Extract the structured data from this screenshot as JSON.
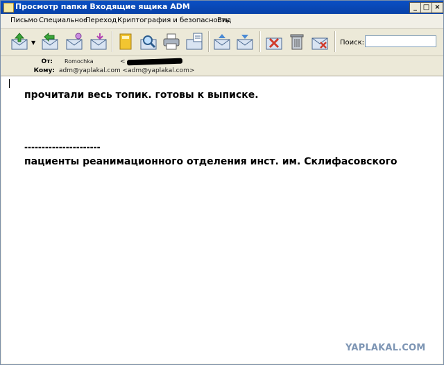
{
  "window": {
    "title": "Просмотр папки Входящие ящика ADM",
    "controls": [
      "_",
      "□",
      "×"
    ]
  },
  "menu": [
    "Письмо",
    "Специальное",
    "Переход",
    "Криптография и безопасность",
    "Вид"
  ],
  "toolbar": {
    "buttons": [
      "get-mail-icon",
      "reply-icon",
      "reply-all-icon",
      "forward-icon",
      "address-book-icon",
      "find-icon",
      "print-icon",
      "compose-icon",
      "previous-message-icon",
      "next-message-icon",
      "mark-spam-icon",
      "delete-icon",
      "delete-forward-icon"
    ],
    "search_label": "Поиск:",
    "search_value": ""
  },
  "header": {
    "from_label": "От:",
    "from_name": "Romochka",
    "from_email": "<",
    "to_label": "Кому:",
    "to_value": "adm@yaplakal.com <adm@yaplakal.com>"
  },
  "message": {
    "line1": "прочитали весь топик. готовы к выписке.",
    "line2": "----------------------",
    "line3": "пациенты реанимационного отделения инст. им. Склифасовского"
  },
  "watermark": "YAPLAKAL.COM"
}
